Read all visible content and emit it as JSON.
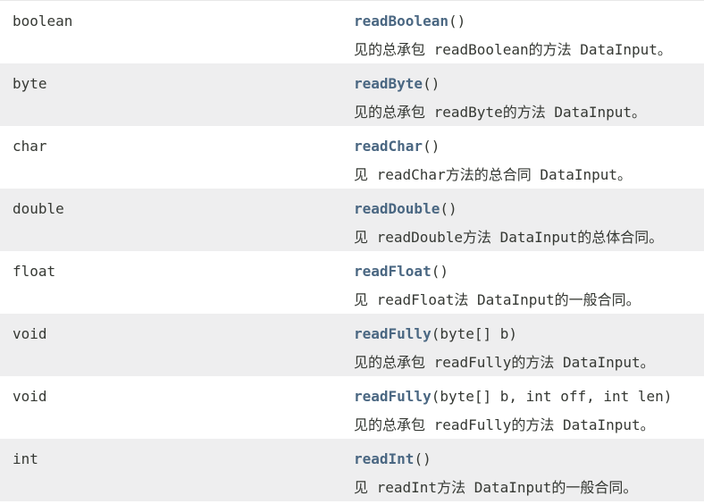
{
  "rows": [
    {
      "type": "boolean",
      "method": "readBoolean",
      "params": "()",
      "desc": "见的总承包 readBoolean的方法 DataInput。"
    },
    {
      "type": "byte",
      "method": "readByte",
      "params": "()",
      "desc": "见的总承包 readByte的方法 DataInput。"
    },
    {
      "type": "char",
      "method": "readChar",
      "params": "()",
      "desc": "见 readChar方法的总合同 DataInput。"
    },
    {
      "type": "double",
      "method": "readDouble",
      "params": "()",
      "desc": "见 readDouble方法 DataInput的总体合同。"
    },
    {
      "type": "float",
      "method": "readFloat",
      "params": "()",
      "desc": "见 readFloat法 DataInput的一般合同。"
    },
    {
      "type": "void",
      "method": "readFully",
      "params": "(byte[] b)",
      "desc": "见的总承包 readFully的方法 DataInput。"
    },
    {
      "type": "void",
      "method": "readFully",
      "params": "(byte[] b, int off, int len)",
      "desc": "见的总承包 readFully的方法 DataInput。"
    },
    {
      "type": "int",
      "method": "readInt",
      "params": "()",
      "desc": "见 readInt方法 DataInput的一般合同。"
    }
  ]
}
